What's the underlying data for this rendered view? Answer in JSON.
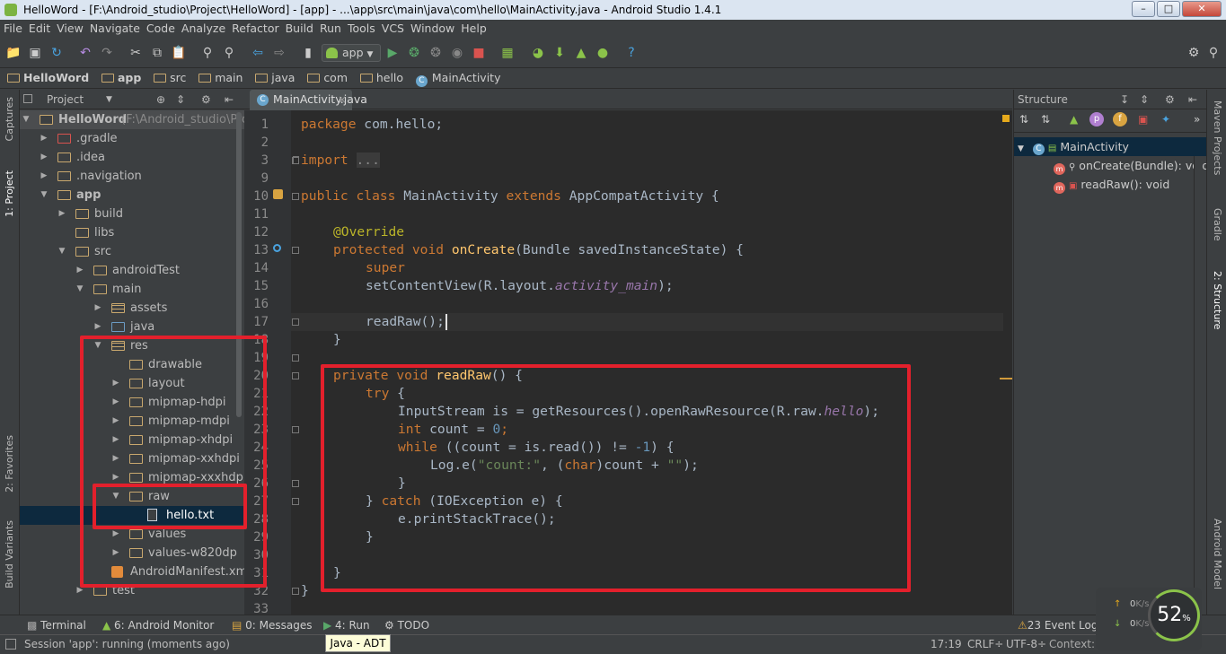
{
  "window": {
    "title": "HelloWord - [F:\\Android_studio\\Project\\HelloWord] - [app] - ...\\app\\src\\main\\java\\com\\hello\\MainActivity.java - Android Studio 1.4.1"
  },
  "menu": [
    "File",
    "Edit",
    "View",
    "Navigate",
    "Code",
    "Analyze",
    "Refactor",
    "Build",
    "Run",
    "Tools",
    "VCS",
    "Window",
    "Help"
  ],
  "toolbar": {
    "run_config": "app"
  },
  "breadcrumb": [
    "HelloWord",
    "app",
    "src",
    "main",
    "java",
    "com",
    "hello",
    "MainActivity"
  ],
  "left_stripe": {
    "captures": "Captures",
    "project": "1: Project",
    "favorites": "2: Favorites",
    "build_variants": "Build Variants"
  },
  "project_panel": {
    "header": "Project",
    "tree": [
      {
        "label": "HelloWord",
        "extra": "(F:\\Android_studio\\Proj"
      },
      {
        "label": ".gradle"
      },
      {
        "label": ".idea"
      },
      {
        "label": ".navigation"
      },
      {
        "label": "app"
      },
      {
        "label": "build"
      },
      {
        "label": "libs"
      },
      {
        "label": "src"
      },
      {
        "label": "androidTest"
      },
      {
        "label": "main"
      },
      {
        "label": "assets"
      },
      {
        "label": "java"
      },
      {
        "label": "res"
      },
      {
        "label": "drawable"
      },
      {
        "label": "layout"
      },
      {
        "label": "mipmap-hdpi"
      },
      {
        "label": "mipmap-mdpi"
      },
      {
        "label": "mipmap-xhdpi"
      },
      {
        "label": "mipmap-xxhdpi"
      },
      {
        "label": "mipmap-xxxhdpi"
      },
      {
        "label": "raw"
      },
      {
        "label": "hello.txt"
      },
      {
        "label": "values"
      },
      {
        "label": "values-w820dp"
      },
      {
        "label": "AndroidManifest.xm"
      },
      {
        "label": "test"
      }
    ]
  },
  "editor": {
    "tab": "MainActivity.java",
    "line_numbers": [
      "1",
      "2",
      "3",
      "9",
      "10",
      "11",
      "12",
      "13",
      "14",
      "15",
      "16",
      "17",
      "18",
      "19",
      "20",
      "21",
      "22",
      "23",
      "24",
      "25",
      "26",
      "27",
      "28",
      "29",
      "30",
      "31",
      "32",
      "33"
    ],
    "tokens": {
      "package": "package",
      "pkg": " com.hello;",
      "import": "import",
      "dots": "...",
      "public": "public",
      "class": "class",
      "clsname": " MainActivity ",
      "extends": "extends",
      "super_cls": " AppCompatActivity {",
      "override": "@Override",
      "protected": "protected",
      "void": "void",
      "oncreate": "onCreate",
      "oncreate_params": "(Bundle savedInstanceState) {",
      "super": "super",
      ".oncreate_call": ".onCreate(savedInstanceState);",
      "setcontent": "setContentView(R.layout.",
      "activity_main": "activity_main",
      "close_paren_semi": ");",
      "readraw_call": "readRaw();",
      "close_brace": "}",
      "private": "private",
      "readraw": "readRaw",
      "readraw_tail": "() {",
      "try": "try",
      "open_brace": " {",
      "inputstream": "InputStream is = getResources().openRawResource(R.raw.",
      "hello": "hello",
      "int": "int",
      "count_decl": " count = ",
      "zero": "0",
      "semi": ";",
      "while": "while",
      "while_cond": " ((count = is.read()) != ",
      "minus_one": "-1",
      ") {": ") {",
      "log_e": "Log.e(",
      "count_str": "\"count:\"",
      ", (": ", (",
      "char": "char",
      ")count + ": ")count + ",
      "empty_str": "\"\"",
      "catch_pre": "} ",
      "catch": "catch",
      "catch_tail": " (IOException e) {",
      "print": "e.printStackTrace();"
    }
  },
  "structure_panel": {
    "header": "Structure",
    "root": "MainActivity",
    "members": [
      "onCreate(Bundle): void",
      "readRaw(): void"
    ]
  },
  "right_stripe": {
    "maven": "Maven Projects",
    "gradle": "Gradle",
    "structure": "2: Structure",
    "android_model": "Android Model"
  },
  "bottom_tools": {
    "terminal": "Terminal",
    "android_monitor": "6: Android Monitor",
    "messages": "0: Messages",
    "run": "4: Run",
    "todo": "TODO",
    "event_log": "23 Event Log"
  },
  "status": {
    "session": "Session 'app': running (moments ago)",
    "tooltip": "Java - ADT",
    "position": "17:19",
    "line_sep": "CRLF÷",
    "encoding": "UTF-8÷",
    "context": "Context: <no context>"
  },
  "memory": {
    "percent": "52",
    "unit": "%",
    "up": "0",
    "down": "0",
    "speed_unit": "K/s"
  }
}
